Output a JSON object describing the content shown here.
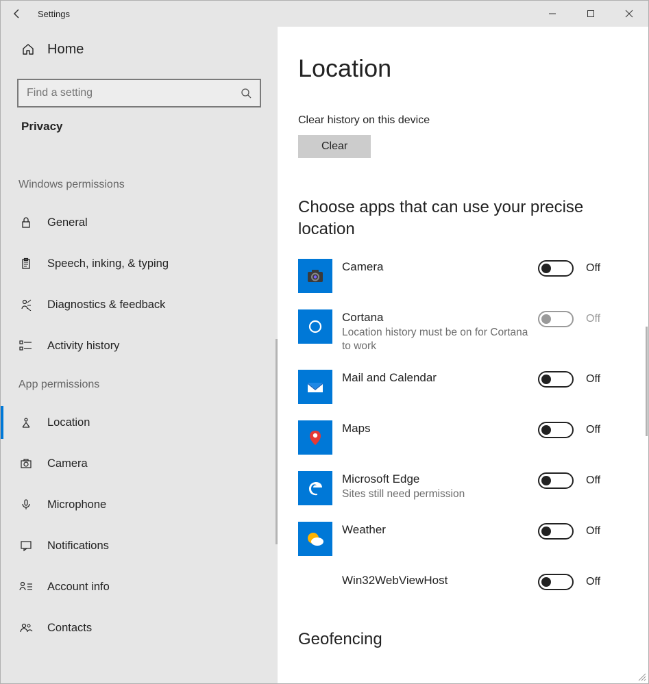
{
  "titlebar": {
    "title": "Settings"
  },
  "sidebar": {
    "home_label": "Home",
    "search_placeholder": "Find a setting",
    "category_label": "Privacy",
    "group_windows": "Windows permissions",
    "group_app": "App permissions",
    "windows_items": [
      {
        "label": "General"
      },
      {
        "label": "Speech, inking, & typing"
      },
      {
        "label": "Diagnostics & feedback"
      },
      {
        "label": "Activity history"
      }
    ],
    "app_items": [
      {
        "label": "Location"
      },
      {
        "label": "Camera"
      },
      {
        "label": "Microphone"
      },
      {
        "label": "Notifications"
      },
      {
        "label": "Account info"
      },
      {
        "label": "Contacts"
      }
    ]
  },
  "content": {
    "page_title": "Location",
    "clear_label": "Clear history on this device",
    "clear_button": "Clear",
    "apps_section": "Choose apps that can use your precise location",
    "geofencing": "Geofencing",
    "off": "Off",
    "apps": [
      {
        "name": "Camera",
        "sub": ""
      },
      {
        "name": "Cortana",
        "sub": "Location history must be on for Cortana to work"
      },
      {
        "name": "Mail and Calendar",
        "sub": ""
      },
      {
        "name": "Maps",
        "sub": ""
      },
      {
        "name": "Microsoft Edge",
        "sub": "Sites still need permission"
      },
      {
        "name": "Weather",
        "sub": ""
      },
      {
        "name": "Win32WebViewHost",
        "sub": ""
      }
    ]
  }
}
